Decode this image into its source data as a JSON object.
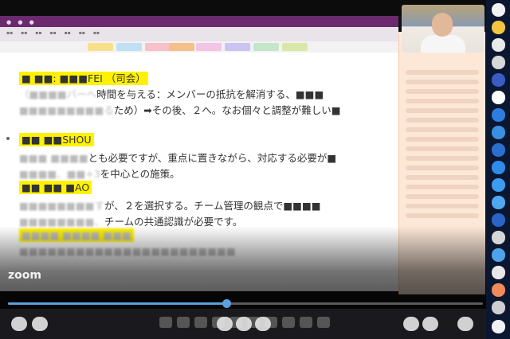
{
  "notes": {
    "lines": [
      {
        "prefix": "",
        "hl": "■ ■■:  ■■■FEI （司会）",
        "rest": ""
      },
      {
        "prefix": "（■■■■バーへ",
        "hl": "",
        "rest": "時間を与える：メンバーの抵抗を解消する、■■■"
      },
      {
        "prefix": "■■■■■■■■■る",
        "hl": "",
        "rest": "ため）➡その後、２へ。なお個々と調整が難しい■"
      },
      {
        "prefix": "",
        "hl": "■■ ■■SHOU",
        "rest": ""
      },
      {
        "prefix": "■■■ ■■■■",
        "hl": "",
        "rest": "とも必要ですが、重点に置きながら、対応する必要が■"
      },
      {
        "prefix": "■■■■、■■+3",
        "hl": "",
        "rest": "を中心との施策。"
      },
      {
        "prefix": "",
        "hl": "■■ ■■ ■AO",
        "rest": ""
      },
      {
        "prefix": "■■■■■■■■す",
        "hl": "",
        "rest": "が、２を選択する。チーム管理の観点で■■■■"
      },
      {
        "prefix": "■■■■■■■■、",
        "hl": "",
        "rest": "チームの共通認識が必要です。"
      },
      {
        "prefix": "",
        "hl": "■■■■ ■■■■ ■■■",
        "rest": ""
      },
      {
        "prefix": "■■■■■■■■■■■■■■■■■■■■■■■",
        "hl": "",
        "rest": ""
      }
    ]
  },
  "overlay": {
    "logo": "zoom"
  },
  "playback": {
    "progress": 0.46
  },
  "colors": {
    "accent": "#5aa0e0",
    "highlight": "#fff200",
    "title_bar": "#6b2a6e"
  }
}
